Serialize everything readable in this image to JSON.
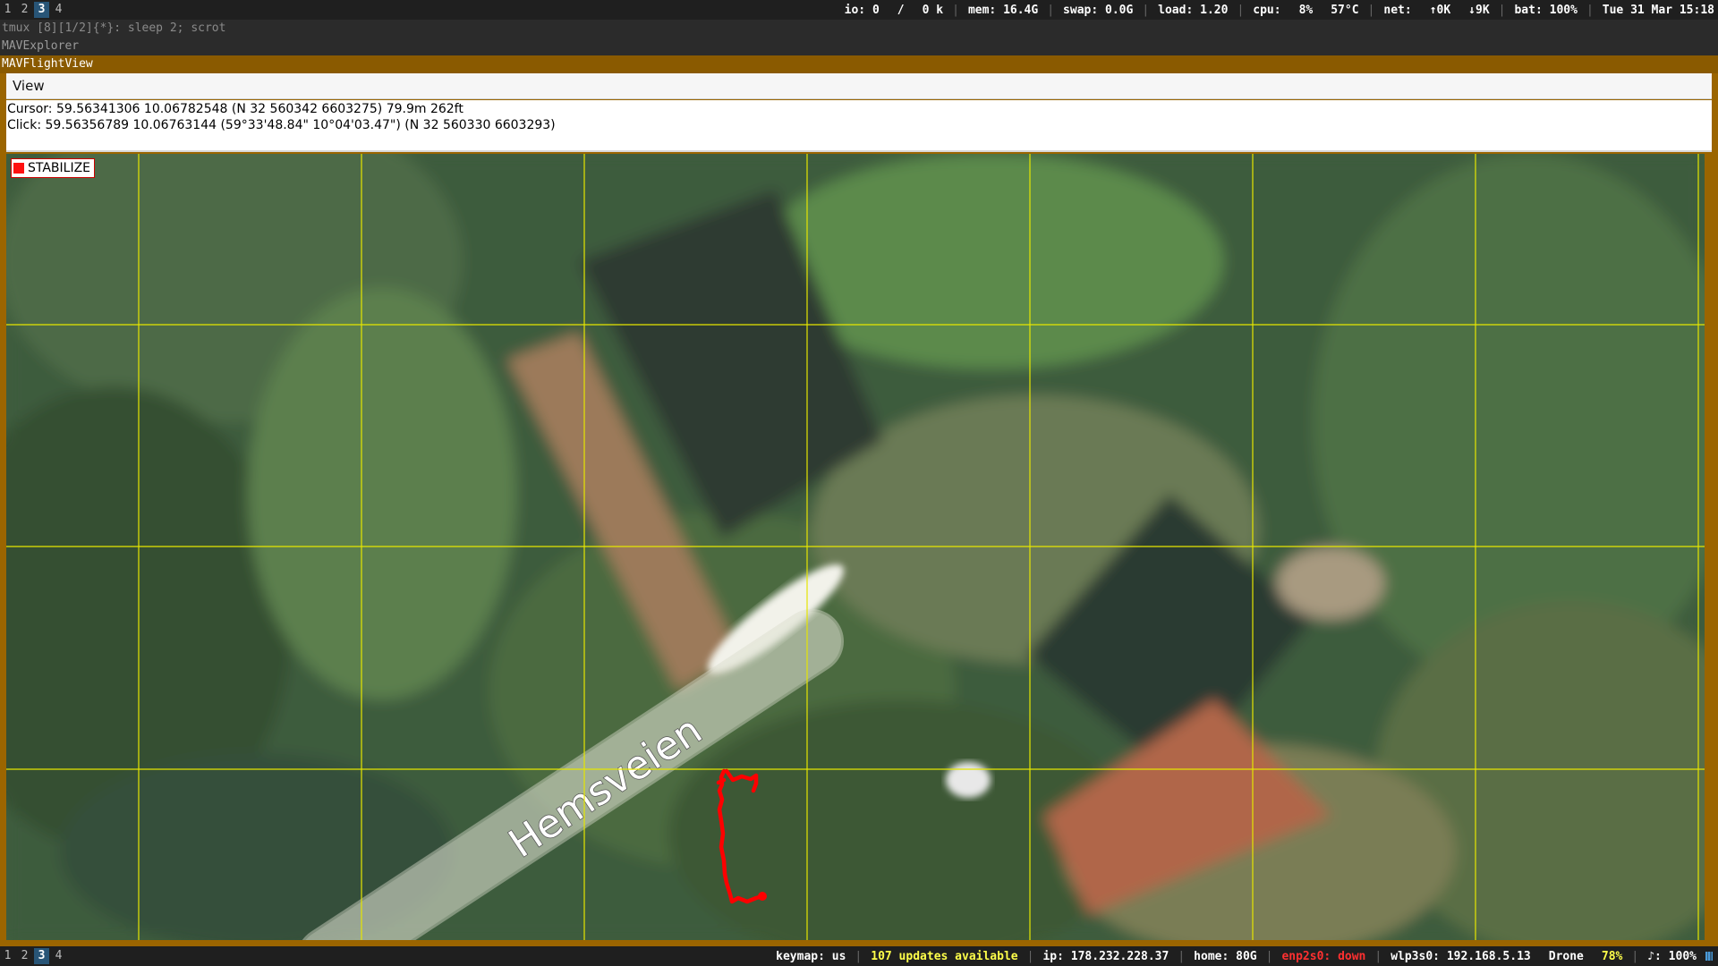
{
  "top_bar": {
    "workspaces": [
      "1",
      "2",
      "3",
      "4"
    ],
    "active_workspace": "3",
    "io": "io: 0",
    "io_sep": "/",
    "io_rate": "0 k",
    "mem": "mem: 16.4G",
    "swap": "swap: 0.0G",
    "load": "load: 1.20",
    "cpu_label": "cpu:",
    "cpu_pct": "8%",
    "cpu_temp": "57°C",
    "net_label": "net:",
    "net_up": "↑0K",
    "net_down": "↓9K",
    "battery": "bat: 100%",
    "datetime": "Tue 31 Mar 15:18"
  },
  "tmux_title": "tmux [8][1/2]{*}:  sleep 2; scrot",
  "explorer_title": "MAVExplorer",
  "flightview_title": "MAVFlightView",
  "menu": {
    "view": "View"
  },
  "info": {
    "cursor": "Cursor: 59.56341306 10.06782548 (N 32 560342 6603275) 79.9m 262ft",
    "click": "Click: 59.56356789 10.06763144 (59°33'48.84\" 10°04'03.47\") (N 32 560330 6603293)"
  },
  "map": {
    "mode": "STABILIZE",
    "road_label": "Hemsveien",
    "grid_color": "#e6e600",
    "track_color": "#ff0000"
  },
  "bottom_bar": {
    "workspaces": [
      "1",
      "2",
      "3",
      "4"
    ],
    "active_workspace": "3",
    "keymap": "keymap: us",
    "updates": "107 updates available",
    "ip": "ip: 178.232.228.37",
    "home": "home: 80G",
    "enp": "enp2s0: down",
    "wlp": "wlp3s0: 192.168.5.13",
    "network_name": "Drone",
    "signal": "78%",
    "volume": "♪: 100%"
  }
}
